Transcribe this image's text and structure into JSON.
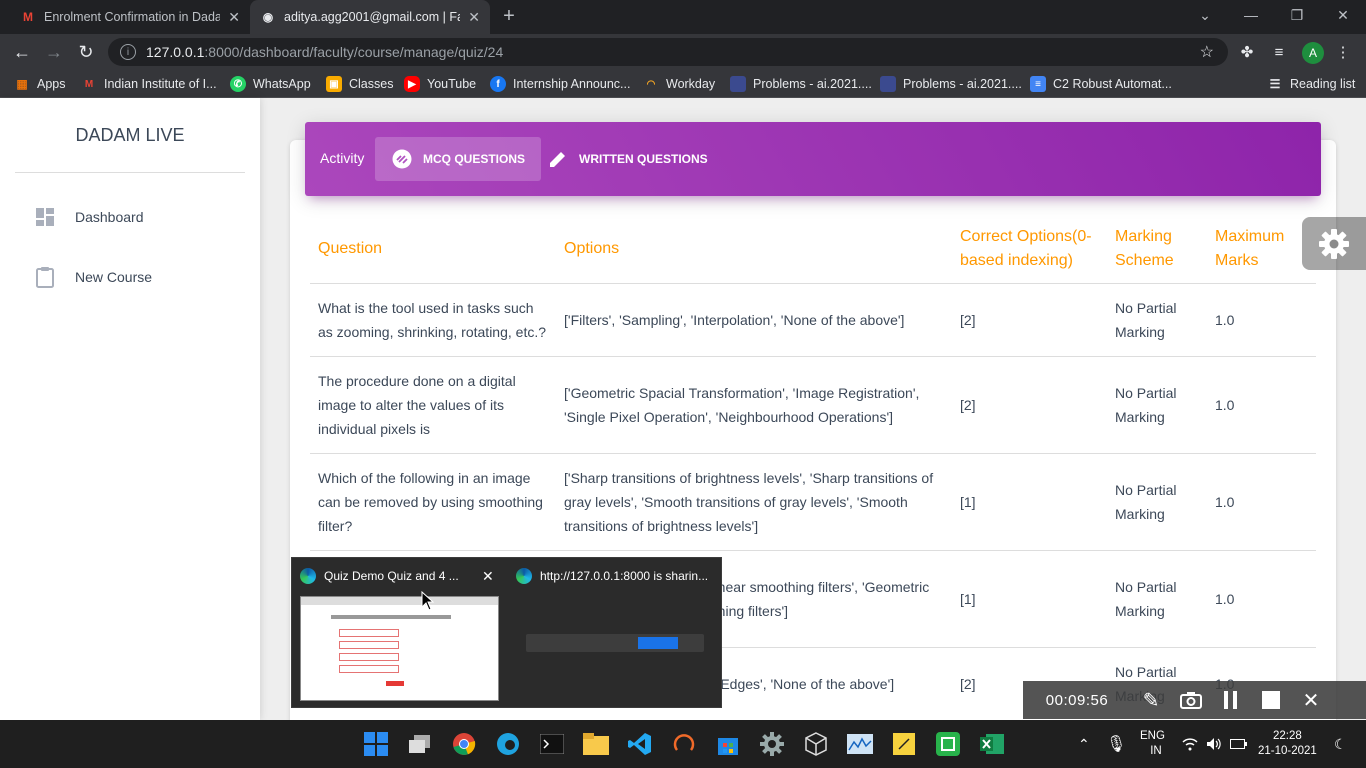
{
  "browser": {
    "tabs": [
      {
        "title": "Enrolment Confirmation in Dadam",
        "favicon": "gmail-icon",
        "active": false
      },
      {
        "title": "aditya.agg2001@gmail.com | Fac",
        "favicon": "chrome-share-icon",
        "active": true
      }
    ],
    "url_host": "127.0.0.1",
    "url_path": ":8000/dashboard/faculty/course/manage/quiz/24",
    "profile_initial": "A",
    "bookmarks": [
      {
        "label": "Apps",
        "icon": "apps-grid-icon",
        "color": "#e8710a"
      },
      {
        "label": "Indian Institute of I...",
        "icon": "gmail-icon",
        "color": "#ea4335"
      },
      {
        "label": "WhatsApp",
        "icon": "whatsapp-icon",
        "color": "#25d366"
      },
      {
        "label": "Classes",
        "icon": "classroom-icon",
        "color": "#f9ab00"
      },
      {
        "label": "YouTube",
        "icon": "youtube-icon",
        "color": "#ff0000"
      },
      {
        "label": "Internship Announc...",
        "icon": "facebook-icon",
        "color": "#1877f2"
      },
      {
        "label": "Workday",
        "icon": "workday-icon",
        "color": "#f5a623"
      },
      {
        "label": "Problems - ai.2021....",
        "icon": "page-icon",
        "color": "#3b4a8f"
      },
      {
        "label": "Problems - ai.2021....",
        "icon": "page-icon",
        "color": "#3b4a8f"
      },
      {
        "label": "C2 Robust Automat...",
        "icon": "docs-icon",
        "color": "#4285f4"
      }
    ],
    "reading_list": "Reading list"
  },
  "sidebar": {
    "brand": "DADAM LIVE",
    "items": [
      {
        "label": "Dashboard",
        "icon": "dashboard-icon"
      },
      {
        "label": "New Course",
        "icon": "clipboard-icon"
      }
    ]
  },
  "header": {
    "activity_label": "Activity",
    "tabs": [
      {
        "label": "MCQ QUESTIONS",
        "icon": "mcq-icon",
        "active": true
      },
      {
        "label": "WRITTEN QUESTIONS",
        "icon": "pencil-icon",
        "active": false
      }
    ]
  },
  "table": {
    "columns": [
      "Question",
      "Options",
      "Correct Options(0-based indexing)",
      "Marking Scheme",
      "Maximum Marks"
    ],
    "rows": [
      {
        "question": "What is the tool used in tasks such as zooming, shrinking, rotating, etc.?",
        "options": "['Filters', 'Sampling', 'Interpolation', 'None of the above']",
        "correct": "[2]",
        "scheme": "No Partial Marking",
        "marks": "1.0"
      },
      {
        "question": "The procedure done on a digital image to alter the values of its individual pixels is",
        "options": "['Geometric Spacial Transformation', 'Image Registration', 'Single Pixel Operation', 'Neighbourhood Operations']",
        "correct": "[2]",
        "scheme": "No Partial Marking",
        "marks": "1.0"
      },
      {
        "question": "Which of the following in an image can be removed by using smoothing filter?",
        "options": "['Sharp transitions of brightness levels', 'Sharp transitions of gray levels', 'Smooth transitions of gray levels', 'Smooth transitions of brightness levels']",
        "correct": "[1]",
        "scheme": "No Partial Marking",
        "marks": "1.0"
      },
      {
        "question": "",
        "options": "...near smoothing filters', 'Geometric ...hing filters']",
        "correct": "[1]",
        "scheme": "No Partial Marking",
        "marks": "1.0"
      },
      {
        "question": "",
        "options": "...'Edges', 'None of the above']",
        "correct": "[2]",
        "scheme": "No Partial Marking",
        "marks": "1.0"
      }
    ]
  },
  "taskbar_preview": {
    "window1_title": "Quiz Demo Quiz and 4 ...",
    "window2_title": "http://127.0.0.1:8000 is sharin..."
  },
  "recorder": {
    "time": "00:09:56"
  },
  "tray": {
    "lang_top": "ENG",
    "lang_bottom": "IN",
    "time": "22:28",
    "date": "21-10-2021"
  }
}
